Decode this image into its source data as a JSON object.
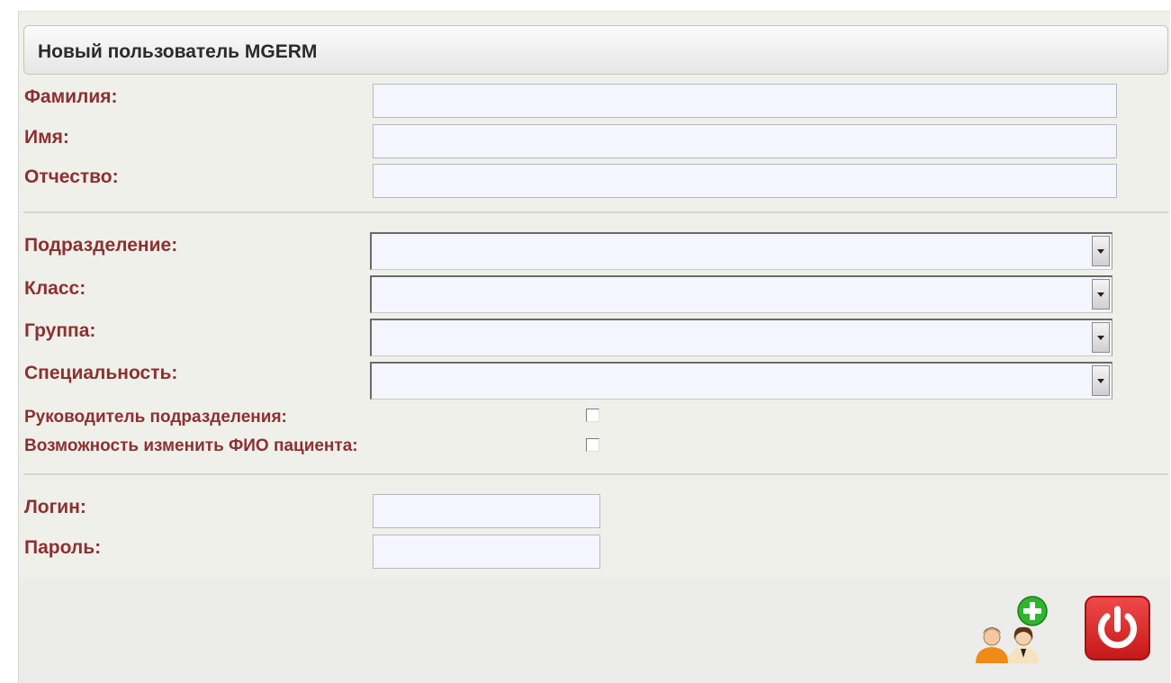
{
  "form": {
    "title": "Новый пользователь MGERM",
    "fields": {
      "last_name": {
        "label": "Фамилия:",
        "value": ""
      },
      "first_name": {
        "label": "Имя:",
        "value": ""
      },
      "patronymic": {
        "label": "Отчество:",
        "value": ""
      }
    },
    "selects": {
      "department": {
        "label": "Подразделение:",
        "value": ""
      },
      "class": {
        "label": "Класс:",
        "value": ""
      },
      "group": {
        "label": "Группа:",
        "value": ""
      },
      "specialty": {
        "label": "Специальность:",
        "value": ""
      }
    },
    "checkboxes": {
      "department_head": {
        "label": "Руководитель подразделения:",
        "checked": false
      },
      "can_edit_patient_name": {
        "label": "Возможность изменить ФИО пациента:",
        "checked": false
      }
    },
    "credentials": {
      "login": {
        "label": "Логин:",
        "value": ""
      },
      "password": {
        "label": "Пароль:",
        "value": ""
      }
    }
  },
  "actions": {
    "add_user_icon": "add-user-icon",
    "power_icon": "power-icon"
  },
  "colors": {
    "label": "#8d3030",
    "input_bg": "#f5f5ff",
    "panel_bg": "#f0f0eb",
    "power_red": "#d92020",
    "add_green": "#2eb52e"
  }
}
